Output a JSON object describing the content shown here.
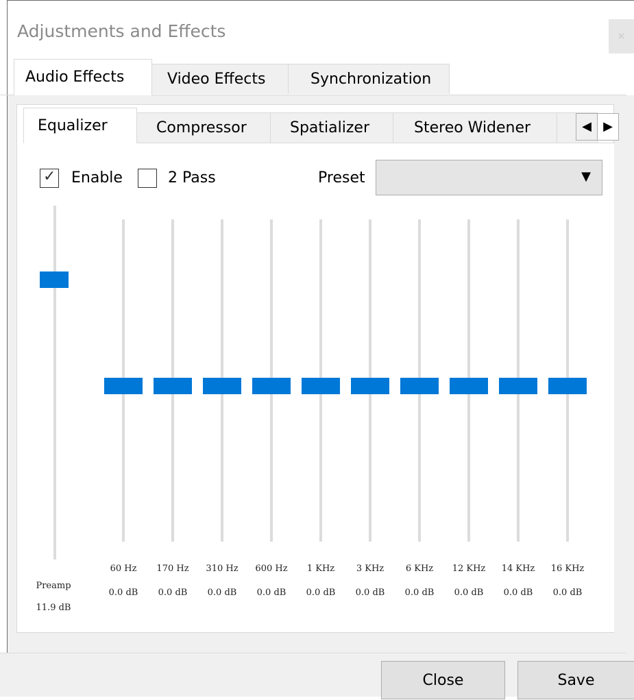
{
  "window": {
    "title": "Adjustments and Effects",
    "close_glyph": "×"
  },
  "outer_tabs": [
    {
      "label": "Audio Effects"
    },
    {
      "label": "Video Effects"
    },
    {
      "label": "Synchronization"
    }
  ],
  "inner_tabs": [
    {
      "label": "Equalizer"
    },
    {
      "label": "Compressor"
    },
    {
      "label": "Spatializer"
    },
    {
      "label": "Stereo Widener"
    }
  ],
  "tab_scroll": {
    "left_glyph": "◀",
    "right_glyph": "▶"
  },
  "equalizer": {
    "enable": {
      "label": "Enable",
      "checked": true
    },
    "two_pass": {
      "label": "2 Pass",
      "checked": false
    },
    "preset": {
      "label": "Preset",
      "value": ""
    },
    "preamp": {
      "name": "Preamp",
      "value": "11.9 dB",
      "level": 0.79
    },
    "bands": [
      {
        "freq": "60 Hz",
        "value": "0.0 dB",
        "level": 0.5
      },
      {
        "freq": "170 Hz",
        "value": "0.0 dB",
        "level": 0.5
      },
      {
        "freq": "310 Hz",
        "value": "0.0 dB",
        "level": 0.5
      },
      {
        "freq": "600 Hz",
        "value": "0.0 dB",
        "level": 0.5
      },
      {
        "freq": "1 KHz",
        "value": "0.0 dB",
        "level": 0.5
      },
      {
        "freq": "3 KHz",
        "value": "0.0 dB",
        "level": 0.5
      },
      {
        "freq": "6 KHz",
        "value": "0.0 dB",
        "level": 0.5
      },
      {
        "freq": "12 KHz",
        "value": "0.0 dB",
        "level": 0.5
      },
      {
        "freq": "14 KHz",
        "value": "0.0 dB",
        "level": 0.5
      },
      {
        "freq": "16 KHz",
        "value": "0.0 dB",
        "level": 0.5
      }
    ]
  },
  "buttons": {
    "close": "Close",
    "save": "Save"
  },
  "colors": {
    "slider_thumb": "#0078d7",
    "track": "#dcdcdc",
    "window_bg": "#f0f0f0"
  }
}
